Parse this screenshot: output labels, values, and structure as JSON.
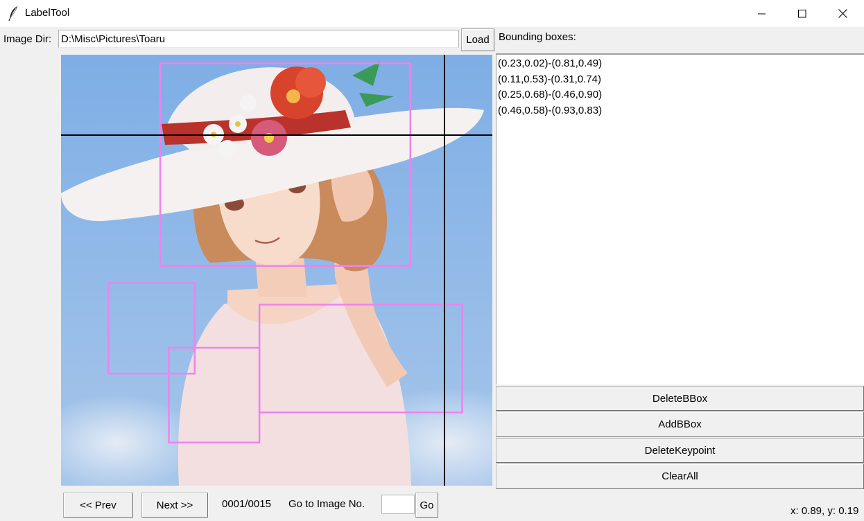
{
  "window": {
    "title": "LabelTool",
    "icon": "feather-icon",
    "controls": [
      "minimize-icon",
      "maximize-icon",
      "close-icon"
    ]
  },
  "toolbar": {
    "image_dir_label": "Image Dir:",
    "image_dir_value": "D:\\Misc\\Pictures\\Toaru",
    "load_label": "Load"
  },
  "bbox_panel": {
    "title": "Bounding boxes:",
    "items": [
      "(0.23,0.02)-(0.81,0.49)",
      "(0.11,0.53)-(0.31,0.74)",
      "(0.25,0.68)-(0.46,0.90)",
      "(0.46,0.58)-(0.93,0.83)"
    ],
    "buttons": {
      "delete_bbox": "DeleteBBox",
      "add_bbox": "AddBBox",
      "delete_keypoint": "DeleteKeypoint",
      "clear_all": "ClearAll"
    }
  },
  "nav": {
    "prev_label": "<< Prev",
    "next_label": "Next >>",
    "counter": "0001/0015",
    "goto_label": "Go to Image No.",
    "goto_value": "",
    "go_label": "Go"
  },
  "status": {
    "cursor": "x: 0.89, y: 0.19"
  },
  "colors": {
    "bbox_stroke": "#ee82ee",
    "crosshair": "#000000",
    "sky": "#8ab4e4"
  }
}
